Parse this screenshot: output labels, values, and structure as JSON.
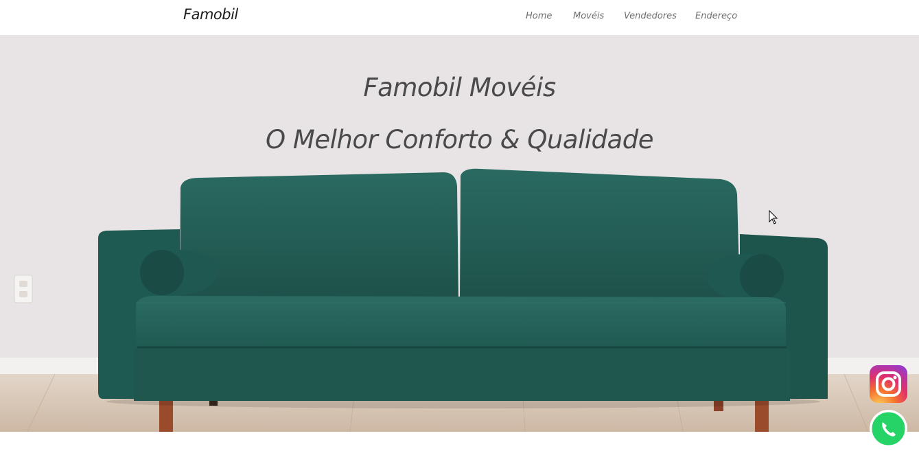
{
  "navbar": {
    "brand": "Famobil",
    "links": [
      {
        "label": "Home"
      },
      {
        "label": "Movéis"
      },
      {
        "label": "Vendedores"
      },
      {
        "label": "Endereço"
      }
    ]
  },
  "hero": {
    "title": "Famobil Movéis",
    "subtitle": "O Melhor Conforto & Qualidade",
    "image": "green-velvet-sofa-photo"
  },
  "social": {
    "instagram": {
      "icon": "instagram-icon",
      "color": "#e1306c"
    },
    "whatsapp": {
      "icon": "whatsapp-icon",
      "color": "#25d366"
    }
  },
  "colors": {
    "sofa": "#1f5a52",
    "wall": "#e7e3e4",
    "floor": "#d8c6b5"
  }
}
